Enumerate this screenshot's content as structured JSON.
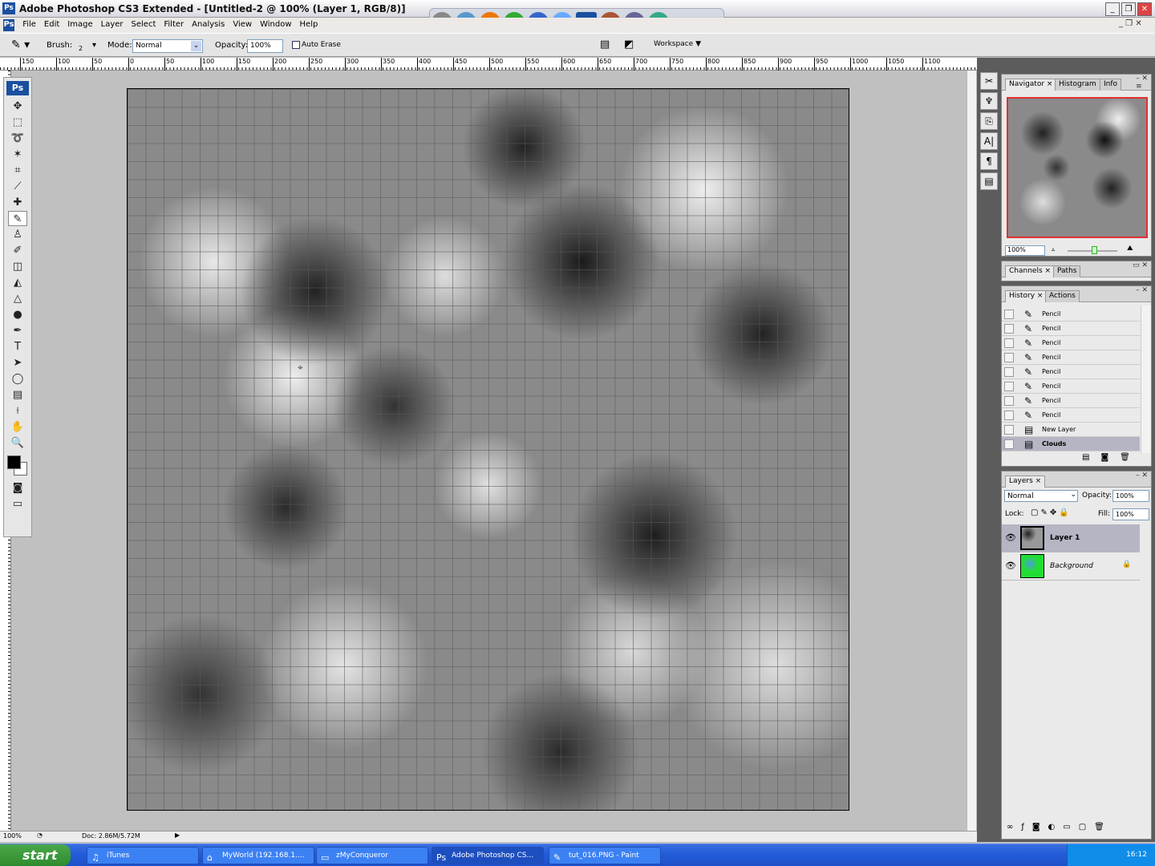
{
  "app": {
    "title": "Adobe Photoshop CS3 Extended - [Untitled-2 @ 100% (Layer 1, RGB/8)]",
    "logo": "Ps"
  },
  "menu": [
    "File",
    "Edit",
    "Image",
    "Layer",
    "Select",
    "Filter",
    "Analysis",
    "View",
    "Window",
    "Help"
  ],
  "options": {
    "brush_label": "Brush:",
    "brush_size": "2",
    "mode_label": "Mode:",
    "mode_value": "Normal",
    "opacity_label": "Opacity:",
    "opacity_value": "100%",
    "auto_erase": "Auto Erase",
    "auto_erase_checked": false,
    "workspace": "Workspace"
  },
  "ruler_top": [
    "150",
    "100",
    "50",
    "0",
    "50",
    "100",
    "150",
    "200",
    "250",
    "300",
    "350",
    "400",
    "450",
    "500",
    "550",
    "600",
    "650",
    "700",
    "750",
    "800",
    "850",
    "900",
    "950",
    "1000",
    "1050",
    "1100"
  ],
  "tools": [
    {
      "name": "move",
      "g": "✥"
    },
    {
      "name": "marquee",
      "g": "⬚"
    },
    {
      "name": "lasso",
      "g": "➰"
    },
    {
      "name": "magic-wand",
      "g": "✶"
    },
    {
      "name": "crop",
      "g": "⌗"
    },
    {
      "name": "slice",
      "g": "⟋"
    },
    {
      "name": "healing",
      "g": "✚"
    },
    {
      "name": "pencil",
      "g": "✎"
    },
    {
      "name": "stamp",
      "g": "♙"
    },
    {
      "name": "history-brush",
      "g": "✐"
    },
    {
      "name": "eraser",
      "g": "◫"
    },
    {
      "name": "paint-bucket",
      "g": "◭"
    },
    {
      "name": "blur",
      "g": "△"
    },
    {
      "name": "dodge",
      "g": "●"
    },
    {
      "name": "pen",
      "g": "✒"
    },
    {
      "name": "type",
      "g": "T"
    },
    {
      "name": "path-select",
      "g": "➤"
    },
    {
      "name": "shape",
      "g": "◯"
    },
    {
      "name": "notes",
      "g": "▤"
    },
    {
      "name": "eyedropper",
      "g": "⟊"
    },
    {
      "name": "hand",
      "g": "✋"
    },
    {
      "name": "zoom",
      "g": "🔍"
    }
  ],
  "colors": {
    "foreground": "#000000",
    "background": "#ffffff",
    "selection": "#b5b5c4",
    "navigator_frame": "#e03030"
  },
  "status": {
    "zoom": "100%",
    "doc": "Doc: 2.86M/5.72M"
  },
  "navigator": {
    "tabs": [
      "Navigator",
      "Histogram",
      "Info"
    ],
    "zoom": "100%"
  },
  "channels": {
    "tabs": [
      "Channels",
      "Paths"
    ]
  },
  "history": {
    "tabs": [
      "History",
      "Actions"
    ],
    "items": [
      "Pencil",
      "Pencil",
      "Pencil",
      "Pencil",
      "Pencil",
      "Pencil",
      "Pencil",
      "Pencil",
      "New Layer",
      "Clouds"
    ],
    "selected": "Clouds"
  },
  "layers": {
    "tab": "Layers",
    "blend": "Normal",
    "opacity_label": "Opacity:",
    "opacity": "100%",
    "lock_label": "Lock:",
    "fill_label": "Fill:",
    "fill": "100%",
    "items": [
      {
        "name": "Layer 1",
        "selected": true
      },
      {
        "name": "Background",
        "locked": true
      }
    ]
  },
  "taskbar": {
    "start": "start",
    "tasks": [
      {
        "label": "iTunes",
        "icon": "♫"
      },
      {
        "label": "MyWorld (192.168.1....",
        "icon": "⌂"
      },
      {
        "label": "zMyConqueror",
        "icon": "▭"
      },
      {
        "label": "Adobe Photoshop CS...",
        "icon": "Ps",
        "active": true
      },
      {
        "label": "tut_016.PNG - Paint",
        "icon": "✎"
      }
    ],
    "clock": "16:12"
  }
}
